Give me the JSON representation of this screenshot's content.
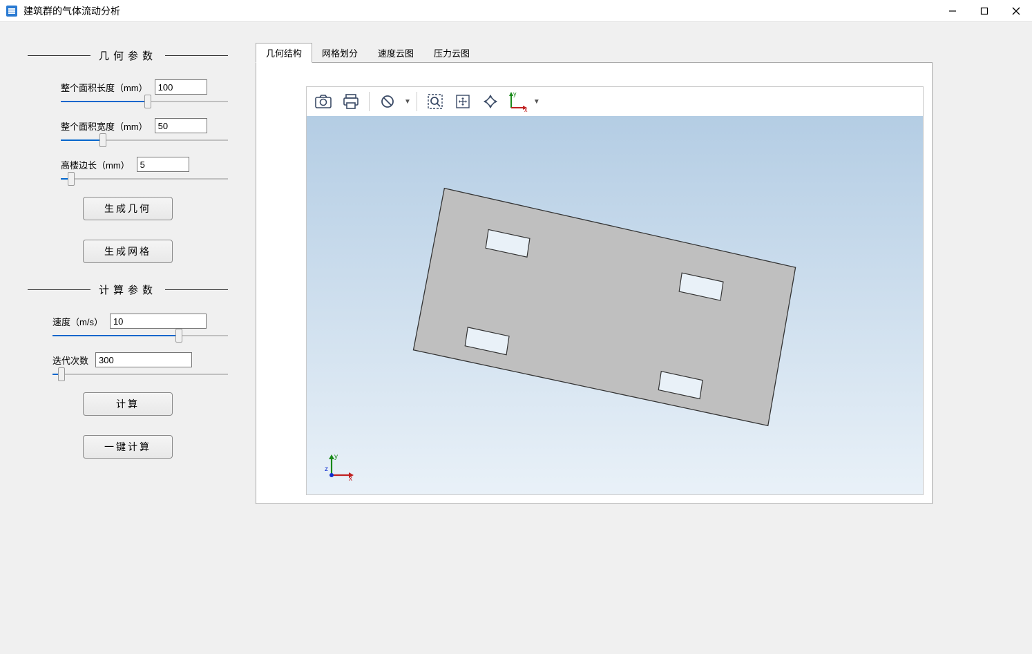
{
  "window": {
    "title": "建筑群的气体流动分析"
  },
  "sidebar": {
    "group_geom": "几何参数",
    "group_calc": "计算参数",
    "length_label": "整个面积长度（mm）",
    "length_value": "100",
    "width_label": "整个面积宽度（mm）",
    "width_value": "50",
    "building_label": "高楼边长（mm）",
    "building_value": "5",
    "btn_gen_geom": "生成几何",
    "btn_gen_mesh": "生成网格",
    "speed_label": "速度（m/s）",
    "speed_value": "10",
    "iter_label": "迭代次数",
    "iter_value": "300",
    "btn_compute": "计算",
    "btn_one_click": "一键计算"
  },
  "tabs": {
    "t1": "几何结构",
    "t2": "网格划分",
    "t3": "速度云图",
    "t4": "压力云图"
  },
  "toolbar": {
    "axis_x": "x",
    "axis_y": "y"
  },
  "viewport": {
    "axis_x": "x",
    "axis_y": "y",
    "axis_z": "z"
  }
}
